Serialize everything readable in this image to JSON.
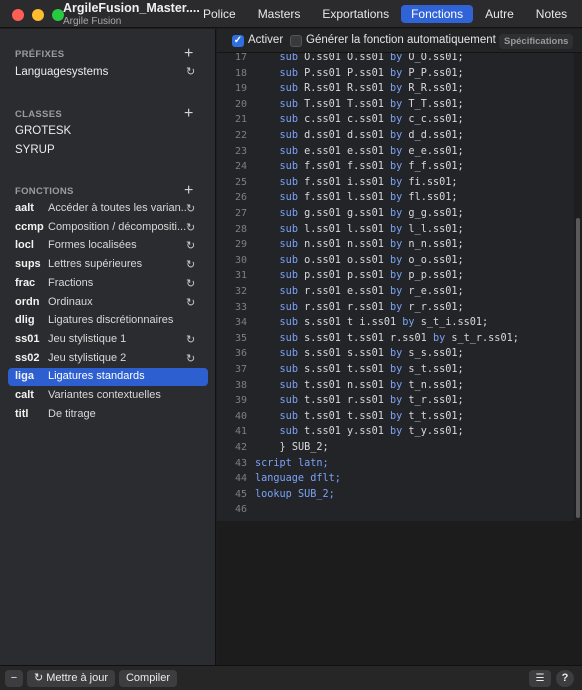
{
  "window": {
    "title": "ArgileFusion_Master....",
    "subtitle": "Argile Fusion",
    "tabs": [
      "Police",
      "Masters",
      "Exportations",
      "Fonctions",
      "Autre",
      "Notes"
    ],
    "active_tab": "Fonctions"
  },
  "sidebar": {
    "prefixes_header": "PRÉFIXES",
    "prefixes": [
      "Languagesystems"
    ],
    "classes_header": "CLASSES",
    "classes": [
      "GROTESK",
      "SYRUP"
    ],
    "features_header": "FONCTIONS",
    "features": [
      {
        "tag": "aalt",
        "name": "Accéder à toutes les varian...",
        "refresh": true
      },
      {
        "tag": "ccmp",
        "name": "Composition / décompositi...",
        "refresh": true
      },
      {
        "tag": "locl",
        "name": "Formes localisées",
        "refresh": true
      },
      {
        "tag": "sups",
        "name": "Lettres supérieures",
        "refresh": true
      },
      {
        "tag": "frac",
        "name": "Fractions",
        "refresh": true
      },
      {
        "tag": "ordn",
        "name": "Ordinaux",
        "refresh": true
      },
      {
        "tag": "dlig",
        "name": "Ligatures discrétionnaires",
        "refresh": false
      },
      {
        "tag": "ss01",
        "name": "Jeu stylistique 1",
        "refresh": true
      },
      {
        "tag": "ss02",
        "name": "Jeu stylistique 2",
        "refresh": true
      },
      {
        "tag": "liga",
        "name": "Ligatures standards",
        "refresh": false,
        "selected": true
      },
      {
        "tag": "calt",
        "name": "Variantes contextuelles",
        "refresh": false
      },
      {
        "tag": "titl",
        "name": "De titrage",
        "refresh": false
      }
    ]
  },
  "editor_toolbar": {
    "activate_label": "Activer",
    "activate_checked": true,
    "autogen_label": "Générer la fonction automatiquement",
    "autogen_checked": false,
    "spec_button": "Spécifications"
  },
  "code": {
    "lines": [
      {
        "n": "17",
        "text": "    sub O.ss01 O.ss01 by O_O.ss01;"
      },
      {
        "n": "18",
        "text": "    sub P.ss01 P.ss01 by P_P.ss01;"
      },
      {
        "n": "19",
        "text": "    sub R.ss01 R.ss01 by R_R.ss01;"
      },
      {
        "n": "20",
        "text": "    sub T.ss01 T.ss01 by T_T.ss01;"
      },
      {
        "n": "21",
        "text": "    sub c.ss01 c.ss01 by c_c.ss01;"
      },
      {
        "n": "22",
        "text": "    sub d.ss01 d.ss01 by d_d.ss01;"
      },
      {
        "n": "23",
        "text": "    sub e.ss01 e.ss01 by e_e.ss01;"
      },
      {
        "n": "24",
        "text": "    sub f.ss01 f.ss01 by f_f.ss01;"
      },
      {
        "n": "25",
        "text": "    sub f.ss01 i.ss01 by fi.ss01;"
      },
      {
        "n": "26",
        "text": "    sub f.ss01 l.ss01 by fl.ss01;"
      },
      {
        "n": "27",
        "text": "    sub g.ss01 g.ss01 by g_g.ss01;"
      },
      {
        "n": "28",
        "text": "    sub l.ss01 l.ss01 by l_l.ss01;"
      },
      {
        "n": "29",
        "text": "    sub n.ss01 n.ss01 by n_n.ss01;"
      },
      {
        "n": "30",
        "text": "    sub o.ss01 o.ss01 by o_o.ss01;"
      },
      {
        "n": "31",
        "text": "    sub p.ss01 p.ss01 by p_p.ss01;"
      },
      {
        "n": "32",
        "text": "    sub r.ss01 e.ss01 by r_e.ss01;"
      },
      {
        "n": "33",
        "text": "    sub r.ss01 r.ss01 by r_r.ss01;"
      },
      {
        "n": "34",
        "text": "    sub s.ss01 t i.ss01 by s_t_i.ss01;"
      },
      {
        "n": "35",
        "text": "    sub s.ss01 t.ss01 r.ss01 by s_t_r.ss01;"
      },
      {
        "n": "36",
        "text": "    sub s.ss01 s.ss01 by s_s.ss01;"
      },
      {
        "n": "37",
        "text": "    sub s.ss01 t.ss01 by s_t.ss01;"
      },
      {
        "n": "38",
        "text": "    sub t.ss01 n.ss01 by t_n.ss01;"
      },
      {
        "n": "39",
        "text": "    sub t.ss01 r.ss01 by t_r.ss01;"
      },
      {
        "n": "40",
        "text": "    sub t.ss01 t.ss01 by t_t.ss01;"
      },
      {
        "n": "41",
        "text": "    sub t.ss01 y.ss01 by t_y.ss01;"
      },
      {
        "n": "42",
        "text": "    } SUB_2;"
      },
      {
        "n": "43",
        "text": "script latn;"
      },
      {
        "n": "44",
        "text": "language dflt;"
      },
      {
        "n": "45",
        "text": "lookup SUB_2;"
      },
      {
        "n": "46",
        "text": ""
      }
    ]
  },
  "bottom": {
    "remove_label": "−",
    "update_label": "Mettre à jour",
    "compile_label": "Compiler",
    "help_label": "?"
  },
  "colors": {
    "accent": "#2f63d6",
    "keyword": "#7aa2f7",
    "close": "#ff5f57",
    "minimize": "#febc2e",
    "zoom": "#28c840"
  }
}
